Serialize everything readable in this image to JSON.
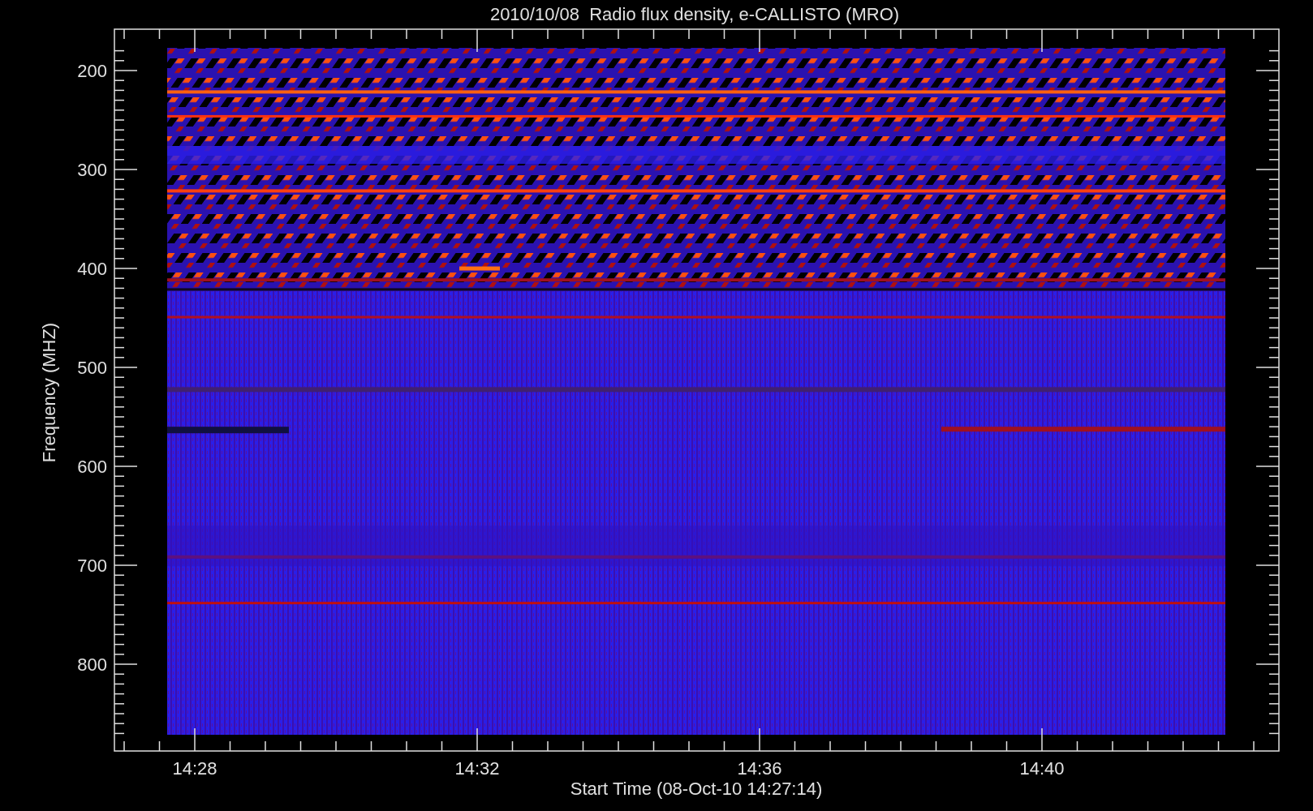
{
  "title": "2010/10/08  Radio flux density, e-CALLISTO (MRO)",
  "y_axis": {
    "label": "Frequency (MHZ)",
    "ticks": [
      "200",
      "300",
      "400",
      "500",
      "600",
      "700",
      "800"
    ]
  },
  "x_axis": {
    "label": "Start Time (08-Oct-10 14:27:14)",
    "ticks": [
      "14:28",
      "14:32",
      "14:36",
      "14:40"
    ]
  }
}
